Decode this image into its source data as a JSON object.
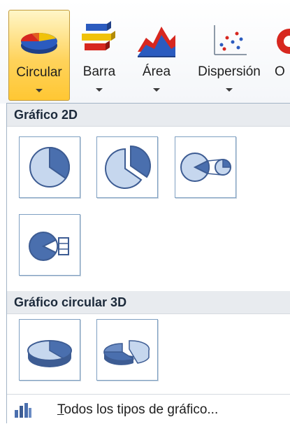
{
  "ribbon": {
    "buttons": [
      {
        "label": "Circular",
        "icon": "pie-chart-icon",
        "active": true
      },
      {
        "label": "Barra",
        "icon": "bar-chart-icon",
        "active": false
      },
      {
        "label": "Área",
        "icon": "area-chart-icon",
        "active": false
      },
      {
        "label": "Dispersión",
        "icon": "scatter-chart-icon",
        "active": false
      },
      {
        "label": "O",
        "icon": "other-chart-icon",
        "active": false
      }
    ]
  },
  "gallery": {
    "section_2d": "Gráfico 2D",
    "section_3d": "Gráfico circular 3D",
    "tiles_2d": [
      "pie-icon",
      "exploded-pie-icon",
      "pie-of-pie-icon",
      "bar-of-pie-icon"
    ],
    "tiles_3d": [
      "pie-3d-icon",
      "exploded-pie-3d-icon"
    ]
  },
  "footer": {
    "accel": "T",
    "rest": "odos los tipos de gráfico...",
    "icon": "all-chart-types-icon"
  },
  "colors": {
    "accent_active": "#ffd35c",
    "pie_blue": "#4a6fae",
    "pie_light": "#c6d7ee"
  }
}
